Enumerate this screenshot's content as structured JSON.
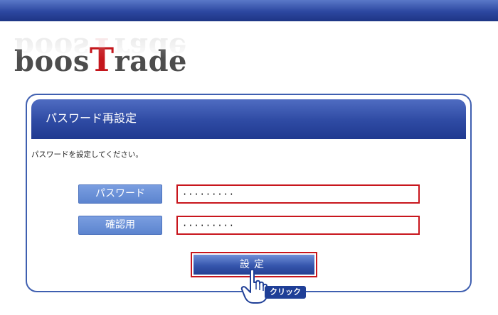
{
  "logo": {
    "prefix": "boos",
    "accent": "T",
    "suffix": "rade"
  },
  "form": {
    "title": "パスワード再設定",
    "instruction": "パスワードを設定してください。",
    "fields": [
      {
        "label": "パスワード",
        "value": "·········"
      },
      {
        "label": "確認用",
        "value": "·········"
      }
    ],
    "submit_label": "設定"
  },
  "annotation": {
    "click_label": "クリック",
    "icon": "pointing-hand-icon"
  },
  "colors": {
    "header_blue": "#2e4aa3",
    "label_blue": "#5c84cf",
    "highlight_red": "#c8161d",
    "logo_red": "#c4161c",
    "logo_gray": "#4d4d4d"
  }
}
